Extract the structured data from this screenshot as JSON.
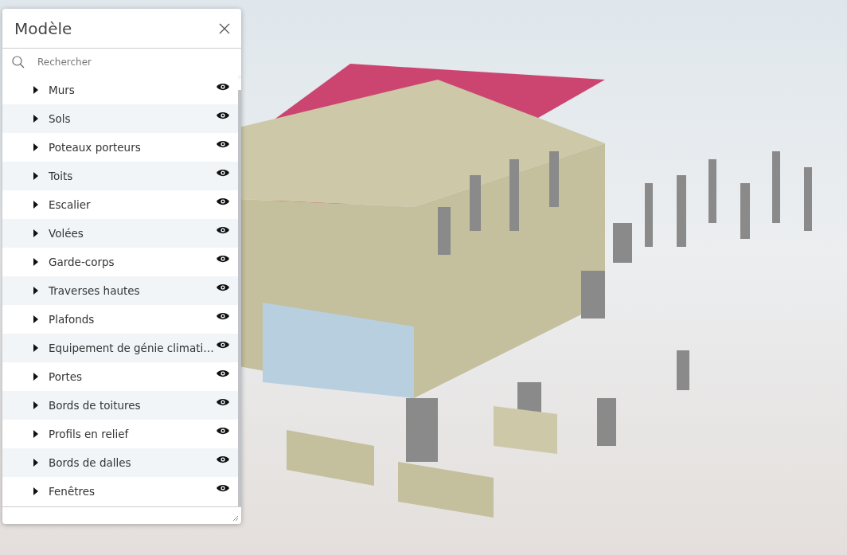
{
  "panel": {
    "title": "Modèle",
    "search": {
      "placeholder": "Rechercher"
    },
    "items": [
      {
        "label": "Murs",
        "expanded": false,
        "visible": true
      },
      {
        "label": "Sols",
        "expanded": false,
        "visible": true
      },
      {
        "label": "Poteaux porteurs",
        "expanded": false,
        "visible": true
      },
      {
        "label": "Toits",
        "expanded": false,
        "visible": true
      },
      {
        "label": "Escalier",
        "expanded": false,
        "visible": true
      },
      {
        "label": "Volées",
        "expanded": false,
        "visible": true
      },
      {
        "label": "Garde-corps",
        "expanded": false,
        "visible": true
      },
      {
        "label": "Traverses hautes",
        "expanded": false,
        "visible": true
      },
      {
        "label": "Plafonds",
        "expanded": false,
        "visible": true
      },
      {
        "label": "Equipement de génie climati…",
        "expanded": false,
        "visible": true
      },
      {
        "label": "Portes",
        "expanded": false,
        "visible": true
      },
      {
        "label": "Bords de toitures",
        "expanded": false,
        "visible": true
      },
      {
        "label": "Profils en relief",
        "expanded": false,
        "visible": true
      },
      {
        "label": "Bords de dalles",
        "expanded": false,
        "visible": true
      },
      {
        "label": "Fenêtres",
        "expanded": false,
        "visible": true
      }
    ]
  }
}
